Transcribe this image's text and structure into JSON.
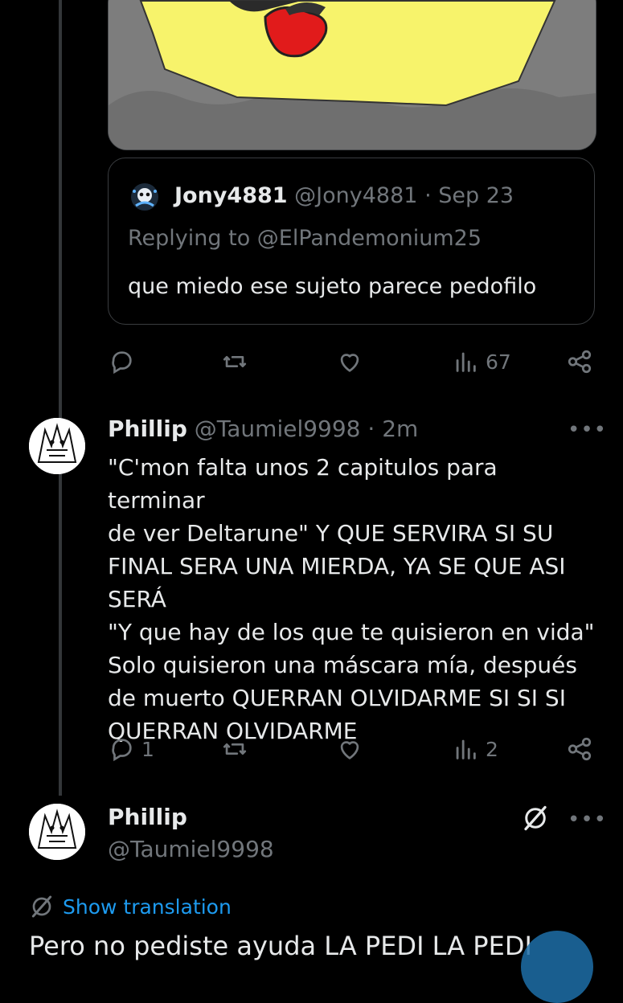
{
  "colors": {
    "background": "#000000",
    "text": "#e7e9ea",
    "muted": "#71767b",
    "accent": "#1d9bf0",
    "border": "#3a3d40"
  },
  "quote": {
    "name": "Jony4881",
    "handle": "@Jony4881",
    "separator": "·",
    "date": "Sep 23",
    "replying_to": "Replying to @ElPandemonium25",
    "text": "que miedo ese sujeto parece pedofilo"
  },
  "action_bar_1": {
    "replies": "",
    "retweets": "",
    "likes": "",
    "views": "67"
  },
  "reply": {
    "name": "Phillip",
    "handle": "@Taumiel9998",
    "separator": "·",
    "time": "2m",
    "more": "•••",
    "lines": [
      "\"C'mon falta unos 2 capitulos para terminar",
      "de ver Deltarune\" Y QUE SERVIRA SI SU",
      "FINAL SERA UNA MIERDA, YA SE QUE ASI",
      "SERÁ",
      "\"Y que hay de los que te quisieron en vida\"",
      "Solo quisieron una máscara mía, después",
      "de muerto QUERRAN OLVIDARME SI SI SI",
      "QUERRAN OLVIDARME"
    ]
  },
  "action_bar_2": {
    "replies": "1",
    "retweets": "",
    "likes": "",
    "views": "2"
  },
  "main_post": {
    "name": "Phillip",
    "handle": "@Taumiel9998",
    "more": "•••",
    "translate_label": "Show translation",
    "text": "Pero no pediste ayuda LA PEDI LA PEDI"
  },
  "icons": [
    "reply-icon",
    "retweet-icon",
    "like-icon",
    "views-icon",
    "share-icon",
    "grok-icon",
    "translate-icon"
  ]
}
